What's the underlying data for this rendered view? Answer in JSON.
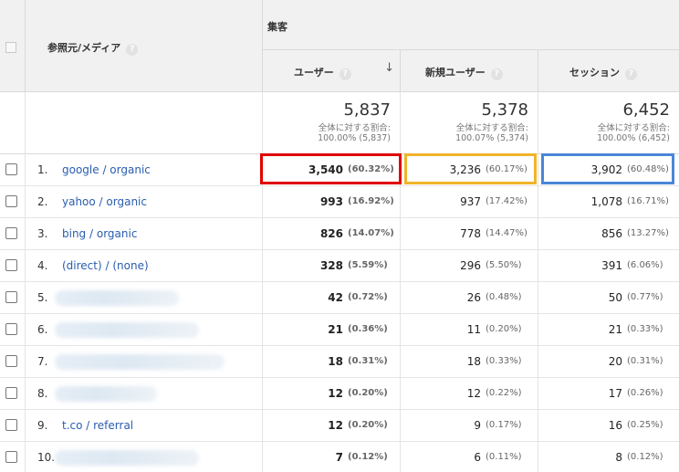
{
  "header": {
    "dimension_label": "参照元/メディア",
    "group_label": "集客",
    "help_glyph": "?",
    "sort_icon": "arrow-down-icon",
    "metrics": [
      {
        "label": "ユーザー"
      },
      {
        "label": "新規ユーザー"
      },
      {
        "label": "セッション"
      }
    ]
  },
  "totals": [
    {
      "value": "5,837",
      "caption": "全体に対する割合:",
      "detail": "100.00% (5,837)"
    },
    {
      "value": "5,378",
      "caption": "全体に対する割合:",
      "detail": "100.07% (5,374)"
    },
    {
      "value": "6,452",
      "caption": "全体に対する割合:",
      "detail": "100.00% (6,452)"
    }
  ],
  "rows": [
    {
      "index": "1.",
      "source": "google / organic",
      "cells": [
        {
          "v": "3,540",
          "p": "(60.32%)"
        },
        {
          "v": "3,236",
          "p": "(60.17%)"
        },
        {
          "v": "3,902",
          "p": "(60.48%)"
        }
      ]
    },
    {
      "index": "2.",
      "source": "yahoo / organic",
      "cells": [
        {
          "v": "993",
          "p": "(16.92%)"
        },
        {
          "v": "937",
          "p": "(17.42%)"
        },
        {
          "v": "1,078",
          "p": "(16.71%)"
        }
      ]
    },
    {
      "index": "3.",
      "source": "bing / organic",
      "cells": [
        {
          "v": "826",
          "p": "(14.07%)"
        },
        {
          "v": "778",
          "p": "(14.47%)"
        },
        {
          "v": "856",
          "p": "(13.27%)"
        }
      ]
    },
    {
      "index": "4.",
      "source": "(direct) / (none)",
      "cells": [
        {
          "v": "328",
          "p": "(5.59%)"
        },
        {
          "v": "296",
          "p": "(5.50%)"
        },
        {
          "v": "391",
          "p": "(6.06%)"
        }
      ]
    },
    {
      "index": "5.",
      "source": "",
      "cells": [
        {
          "v": "42",
          "p": "(0.72%)"
        },
        {
          "v": "26",
          "p": "(0.48%)"
        },
        {
          "v": "50",
          "p": "(0.77%)"
        }
      ]
    },
    {
      "index": "6.",
      "source": "",
      "cells": [
        {
          "v": "21",
          "p": "(0.36%)"
        },
        {
          "v": "11",
          "p": "(0.20%)"
        },
        {
          "v": "21",
          "p": "(0.33%)"
        }
      ]
    },
    {
      "index": "7.",
      "source": "",
      "cells": [
        {
          "v": "18",
          "p": "(0.31%)"
        },
        {
          "v": "18",
          "p": "(0.33%)"
        },
        {
          "v": "20",
          "p": "(0.31%)"
        }
      ]
    },
    {
      "index": "8.",
      "source": "",
      "cells": [
        {
          "v": "12",
          "p": "(0.20%)"
        },
        {
          "v": "12",
          "p": "(0.22%)"
        },
        {
          "v": "17",
          "p": "(0.26%)"
        }
      ]
    },
    {
      "index": "9.",
      "source": "t.co / referral",
      "cells": [
        {
          "v": "12",
          "p": "(0.20%)"
        },
        {
          "v": "9",
          "p": "(0.17%)"
        },
        {
          "v": "16",
          "p": "(0.25%)"
        }
      ]
    },
    {
      "index": "10.",
      "source": "",
      "cells": [
        {
          "v": "7",
          "p": "(0.12%)"
        },
        {
          "v": "6",
          "p": "(0.11%)"
        },
        {
          "v": "8",
          "p": "(0.12%)"
        }
      ]
    }
  ],
  "highlights": {
    "red": "#e00000",
    "yellow": "#f0b429",
    "blue": "#4a86d8"
  },
  "colors": {
    "link": "#2a5db0",
    "header_bg": "#f1f1f1"
  }
}
